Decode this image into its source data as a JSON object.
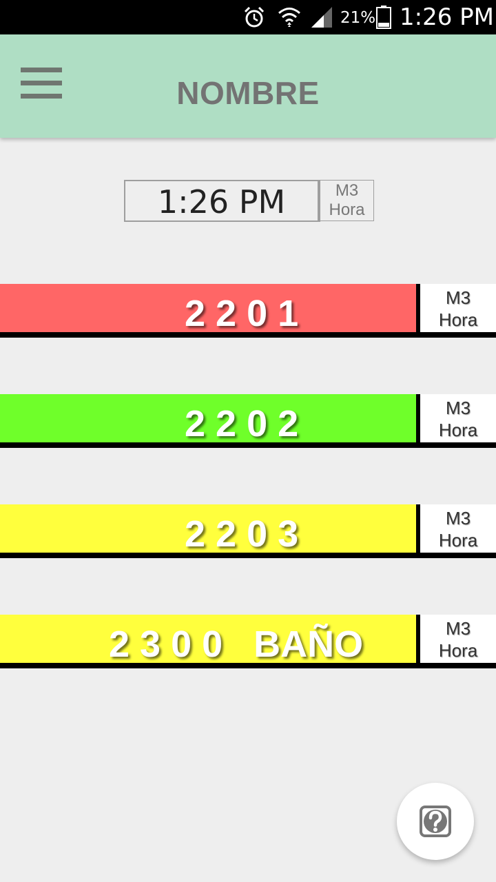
{
  "status_bar": {
    "battery_percent": "21%",
    "time": "1:26 PM",
    "icons": [
      "alarm-icon",
      "wifi-icon",
      "signal-icon",
      "battery-icon"
    ]
  },
  "app_bar": {
    "title": "NOMBRE",
    "menu_icon": "hamburger-menu-icon",
    "background": "#afdec4"
  },
  "clock_display": {
    "time": "1:26 PM",
    "unit_line1": "M3",
    "unit_line2": "Hora"
  },
  "rows": [
    {
      "label": "2 2 0 1",
      "unit_line1": "M3",
      "unit_line2": "Hora",
      "color": "#ff6666"
    },
    {
      "label": "2 2 0 2",
      "unit_line1": "M3",
      "unit_line2": "Hora",
      "color": "#6fff2a"
    },
    {
      "label": "2 2 0 3",
      "unit_line1": "M3",
      "unit_line2": "Hora",
      "color": "#ffff3d"
    },
    {
      "label": "2 3 0 0   BAÑO",
      "unit_line1": "M3",
      "unit_line2": "Hora",
      "color": "#ffff3d"
    }
  ],
  "help_button": {
    "icon": "help-icon"
  }
}
